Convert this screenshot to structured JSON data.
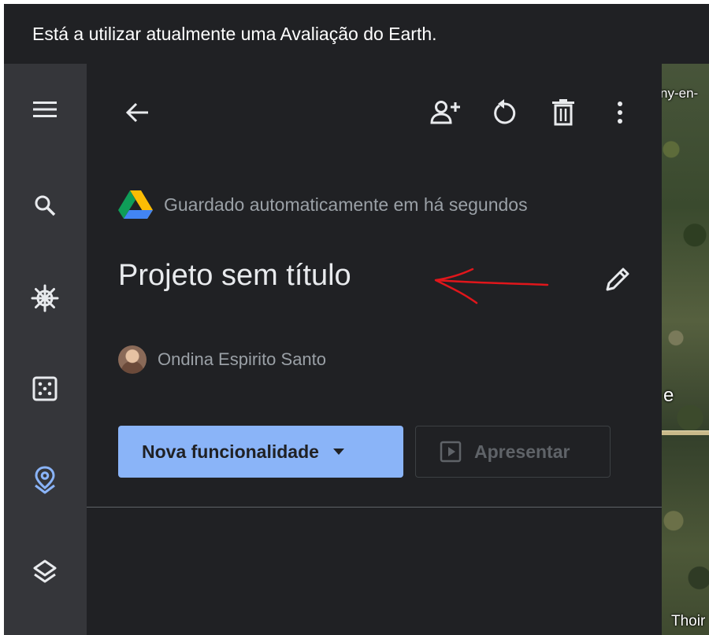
{
  "banner": {
    "text": "Está a utilizar atualmente uma Avaliação do Earth."
  },
  "rail": {
    "items": [
      {
        "icon": "menu-icon"
      },
      {
        "icon": "search-icon"
      },
      {
        "icon": "voyager-helm-icon"
      },
      {
        "icon": "dice-icon"
      },
      {
        "icon": "projects-pin-icon",
        "active": true
      },
      {
        "icon": "layers-icon"
      }
    ]
  },
  "panel": {
    "saved_text": "Guardado automaticamente em há segundos",
    "title": "Projeto sem título",
    "owner": "Ondina Espirito Santo",
    "new_feature_label": "Nova funcionalidade",
    "present_label": "Apresentar"
  },
  "map": {
    "labels": [
      "ny-en-",
      "e",
      "Thoir"
    ]
  },
  "colors": {
    "background": "#202124",
    "rail": "#35363a",
    "accent": "#8ab4f8",
    "annotation": "#e0161b"
  }
}
